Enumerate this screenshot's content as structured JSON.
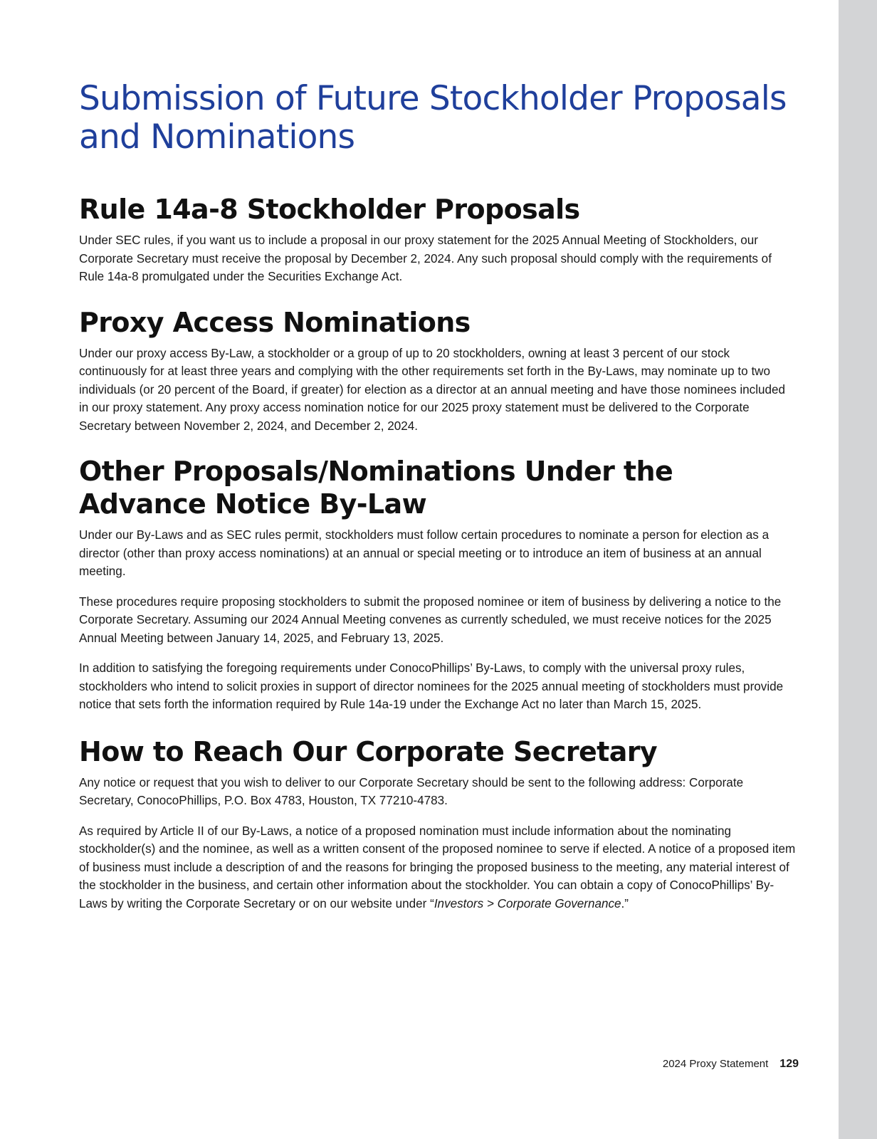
{
  "title": "Submission of Future Stockholder Proposals and Nominations",
  "sections": [
    {
      "heading": "Rule 14a-8 Stockholder Proposals",
      "paragraphs": [
        "Under SEC rules, if you want us to include a proposal in our proxy statement for the 2025 Annual Meeting of Stockholders, our Corporate Secretary must receive the proposal by December 2, 2024. Any such proposal should comply with the requirements of Rule 14a-8 promulgated under the Securities Exchange Act."
      ]
    },
    {
      "heading": "Proxy Access Nominations",
      "paragraphs": [
        "Under our proxy access By-Law, a stockholder or a group of up to 20 stockholders, owning at least 3 percent of our stock continuously for at least three years and complying with the other requirements set forth in the By-Laws, may nominate up to two individuals (or 20 percent of the Board, if greater) for election as a director at an annual meeting and have those nominees included in our proxy statement. Any proxy access nomination notice for our 2025 proxy statement must be delivered to the Corporate Secretary between November 2, 2024, and December 2, 2024."
      ]
    },
    {
      "heading": "Other Proposals/Nominations Under the Advance Notice By-Law",
      "paragraphs": [
        "Under our By-Laws and as SEC rules permit, stockholders must follow certain procedures to nominate a person for election as a director (other than proxy access nominations) at an annual or special meeting or to introduce an item of business at an annual meeting.",
        "These procedures require proposing stockholders to submit the proposed nominee or item of business by delivering a notice to the Corporate Secretary. Assuming our 2024 Annual Meeting convenes as currently scheduled, we must receive notices for the 2025 Annual Meeting between January 14, 2025, and February 13, 2025.",
        "In addition to satisfying the foregoing requirements under ConocoPhillips’ By-Laws, to comply with the universal proxy rules, stockholders who intend to solicit proxies in support of director nominees for the 2025 annual meeting of stockholders must provide notice that sets forth the information required by Rule 14a-19 under the Exchange Act no later than March 15, 2025."
      ]
    },
    {
      "heading": "How to Reach Our Corporate Secretary",
      "paragraphs": [
        "Any notice or request that you wish to deliver to our Corporate Secretary should be sent to the following address: Corporate Secretary, ConocoPhillips, P.O. Box 4783, Houston, TX 77210-4783.",
        "As required by Article II of our By-Laws, a notice of a proposed nomination must include information about the nominating stockholder(s) and the nominee, as well as a written consent of the proposed nominee to serve if elected. A notice of a proposed item of business must include a description of and the reasons for bringing the proposed business to the meeting, any material interest of the stockholder in the business, and certain other information about the stockholder. You can obtain a copy of ConocoPhillips’ By-Laws by writing the Corporate Secretary or on our website under “"
      ],
      "link_path": "Investors > Corporate Governance",
      "link_suffix": ".”"
    }
  ],
  "footer": {
    "document": "2024 Proxy Statement",
    "page_number": "129"
  },
  "colors": {
    "title": "#1f3f9b",
    "side_bar": "#d3d4d6",
    "text": "#1a1a1a"
  }
}
